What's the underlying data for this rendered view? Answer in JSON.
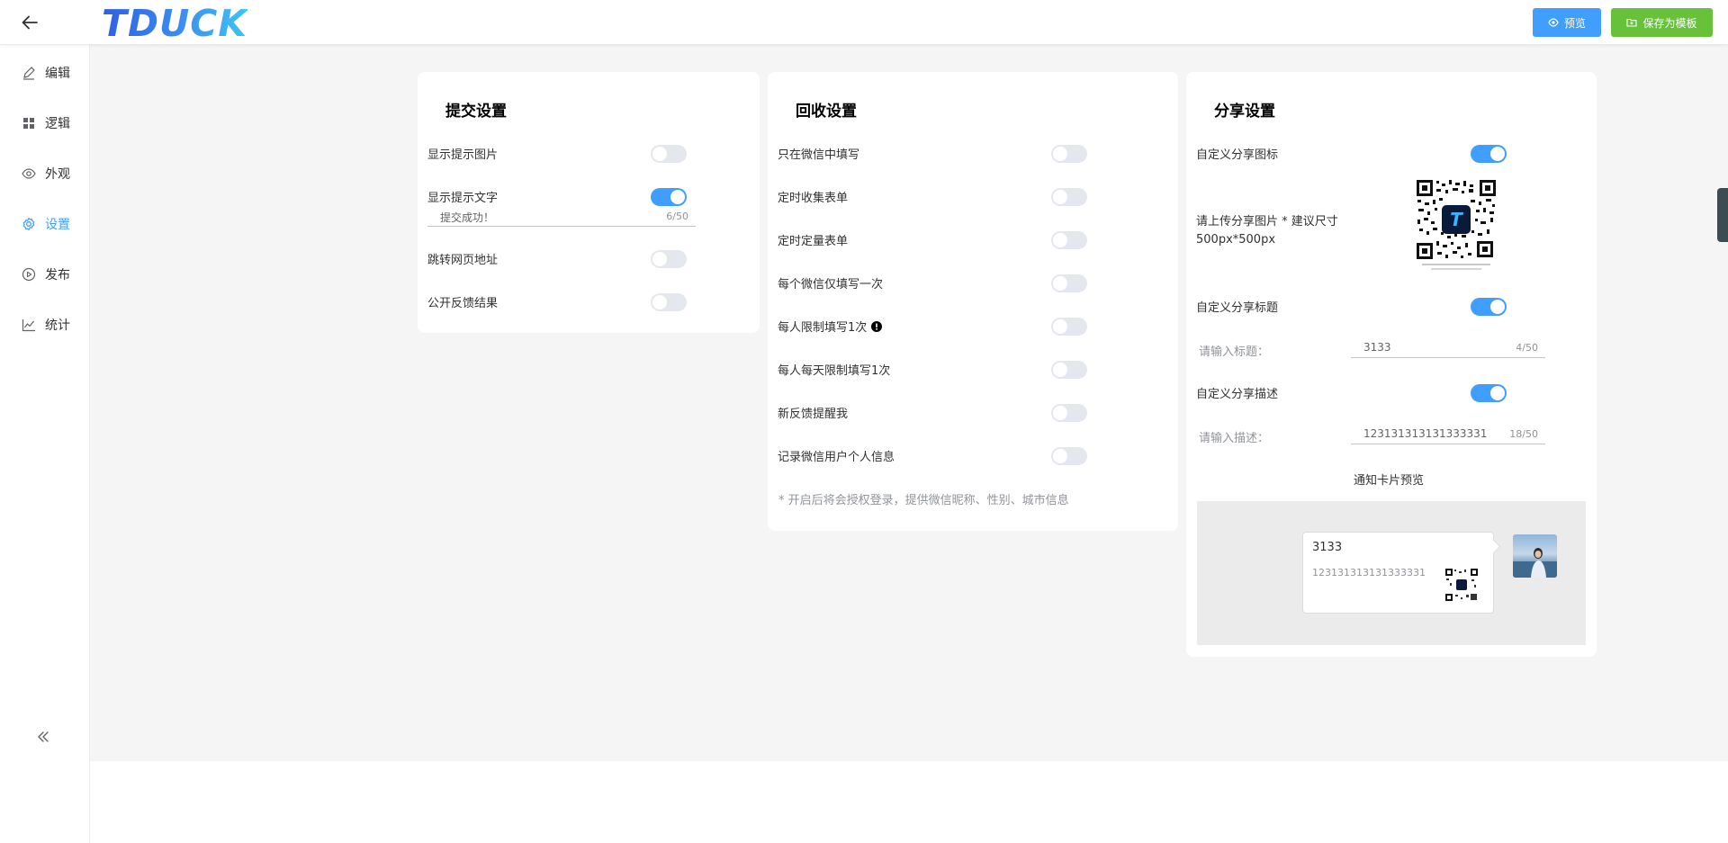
{
  "header": {
    "logo": "TDUCK",
    "preview_label": "预览",
    "save_template_label": "保存为模板"
  },
  "sidebar": {
    "items": [
      {
        "label": "编辑",
        "icon": "edit-icon"
      },
      {
        "label": "逻辑",
        "icon": "grid-icon"
      },
      {
        "label": "外观",
        "icon": "eye-icon"
      },
      {
        "label": "设置",
        "icon": "gear-icon",
        "active": true
      },
      {
        "label": "发布",
        "icon": "play-circle-icon"
      },
      {
        "label": "统计",
        "icon": "chart-icon"
      }
    ]
  },
  "submit_settings": {
    "title": "提交设置",
    "show_image_label": "显示提示图片",
    "show_image_on": false,
    "show_text_label": "显示提示文字",
    "show_text_on": true,
    "text_value": "提交成功！",
    "text_count": "6/50",
    "redirect_label": "跳转网页地址",
    "redirect_on": false,
    "public_result_label": "公开反馈结果",
    "public_result_on": false
  },
  "collect_settings": {
    "title": "回收设置",
    "items": [
      {
        "label": "只在微信中填写",
        "on": false
      },
      {
        "label": "定时收集表单",
        "on": false
      },
      {
        "label": "定时定量表单",
        "on": false
      },
      {
        "label": "每个微信仅填写一次",
        "on": false
      },
      {
        "label": "每人限制填写1次",
        "on": false,
        "warn": true
      },
      {
        "label": "每人每天限制填写1次",
        "on": false
      },
      {
        "label": "新反馈提醒我",
        "on": false
      },
      {
        "label": "记录微信用户个人信息",
        "on": false
      }
    ],
    "hint": "* 开启后将会授权登录，提供微信昵称、性别、城市信息"
  },
  "share_settings": {
    "title": "分享设置",
    "custom_icon_label": "自定义分享图标",
    "custom_icon_on": true,
    "upload_label": "请上传分享图片 * 建议尺寸500px*500px",
    "custom_title_label": "自定义分享标题",
    "custom_title_on": true,
    "title_input_label": "请输入标题：",
    "title_value": "3133",
    "title_count": "4/50",
    "custom_desc_label": "自定义分享描述",
    "custom_desc_on": true,
    "desc_input_label": "请输入描述：",
    "desc_value": "123131313131333331",
    "desc_count": "18/50",
    "card_preview_label": "通知卡片预览",
    "card_title": "3133",
    "card_desc": "123131313131333331"
  },
  "colors": {
    "primary": "#409eff",
    "success": "#67c23a",
    "switch_off": "#e4e7ed"
  }
}
